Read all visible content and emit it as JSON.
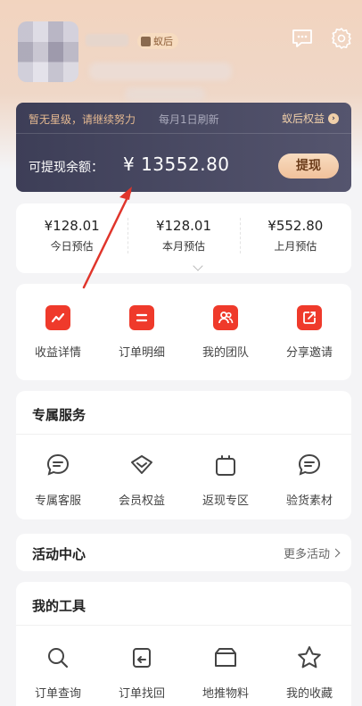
{
  "header": {
    "badge": "蚁后",
    "icons": [
      "message-icon",
      "settings-icon"
    ]
  },
  "balance": {
    "level_notice": "暂无星级，请继续努力",
    "refresh_note": "每月1日刷新",
    "rights_link": "蚁后权益",
    "rights_arrow": "›",
    "label": "可提现余额：",
    "amount": "¥ 13552.80",
    "withdraw_button": "提现"
  },
  "estimates": [
    {
      "value": "¥128.01",
      "label": "今日预估"
    },
    {
      "value": "¥128.01",
      "label": "本月预估"
    },
    {
      "value": "¥552.80",
      "label": "上月预估"
    }
  ],
  "quick_actions": [
    {
      "label": "收益详情",
      "icon": "chart-icon"
    },
    {
      "label": "订单明细",
      "icon": "list-icon"
    },
    {
      "label": "我的团队",
      "icon": "team-icon"
    },
    {
      "label": "分享邀请",
      "icon": "share-icon"
    }
  ],
  "service": {
    "title": "专属服务",
    "items": [
      {
        "label": "专属客服",
        "icon": "chat-icon"
      },
      {
        "label": "会员权益",
        "icon": "diamond-icon"
      },
      {
        "label": "返现专区",
        "icon": "bag-icon"
      },
      {
        "label": "验货素材",
        "icon": "chat-icon"
      }
    ]
  },
  "activity": {
    "title": "活动中心",
    "more": "更多活动"
  },
  "tools": {
    "title": "我的工具",
    "items": [
      {
        "label": "订单查询",
        "icon": "search-icon"
      },
      {
        "label": "订单找回",
        "icon": "return-icon"
      },
      {
        "label": "地推物料",
        "icon": "box-icon"
      },
      {
        "label": "我的收藏",
        "icon": "star-icon"
      }
    ]
  },
  "colors": {
    "accent_red": "#ef3a2b",
    "card_dark": "#3d3e57",
    "gold": "#f0cfa9",
    "annotation_arrow": "#e0352b"
  }
}
